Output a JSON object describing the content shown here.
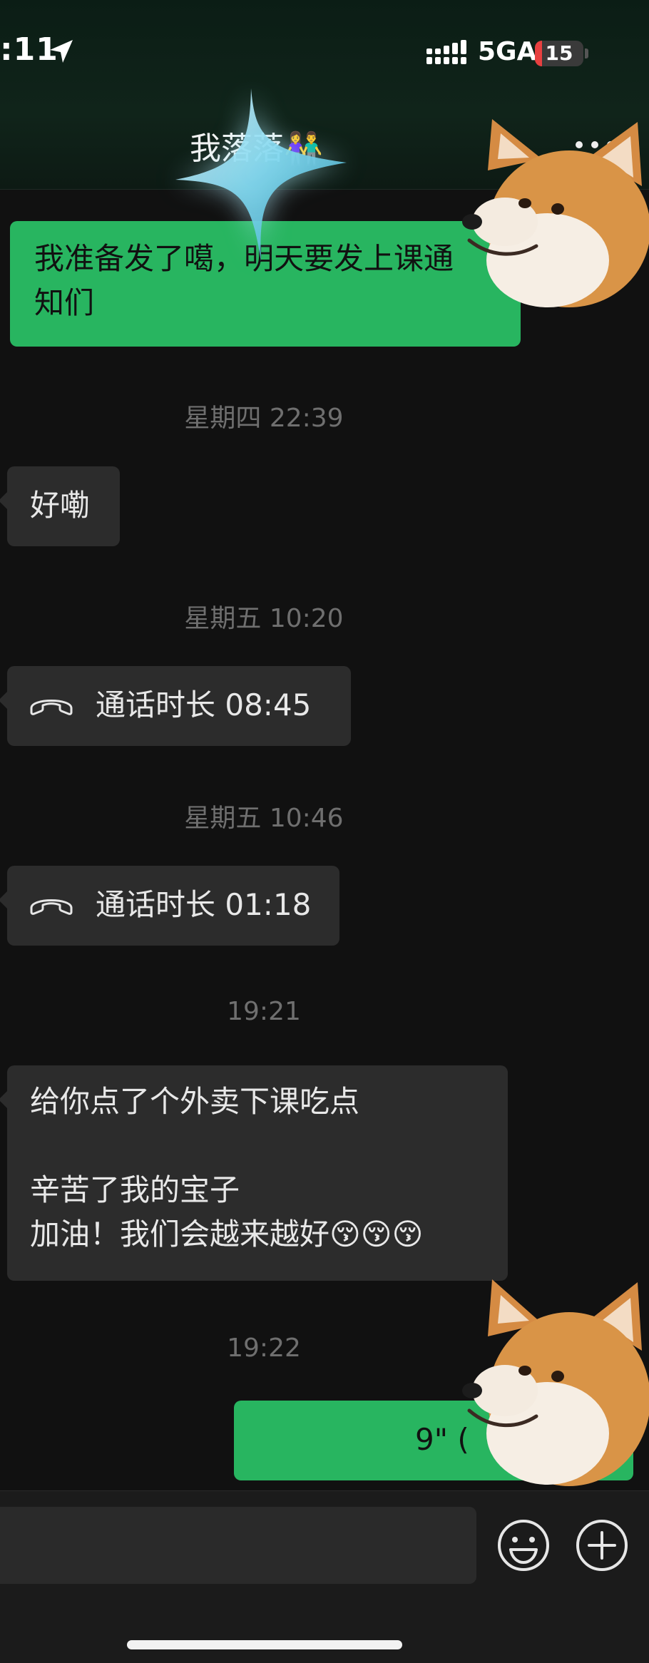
{
  "status_bar": {
    "time": ":11",
    "network": "5GA",
    "battery": "15",
    "battery_level": 0.15
  },
  "header": {
    "title": "我落落👫",
    "more_icon": "ellipsis-icon"
  },
  "messages": [
    {
      "type": "text",
      "side": "right",
      "text_line1": "我准备发了噶，明天要发上课通",
      "text_line2": "知们"
    },
    {
      "type": "time",
      "text": "星期四 22:39"
    },
    {
      "type": "text",
      "side": "left",
      "text": "好嘞"
    },
    {
      "type": "time",
      "text": "星期五 10:20"
    },
    {
      "type": "call",
      "side": "left",
      "icon": "phone-hangup-icon",
      "text": "通话时长 08:45"
    },
    {
      "type": "time",
      "text": "星期五 10:46"
    },
    {
      "type": "call",
      "side": "left",
      "icon": "phone-hangup-icon",
      "text": "通话时长 01:18"
    },
    {
      "type": "time",
      "text": "19:21"
    },
    {
      "type": "text",
      "side": "left",
      "line1": "给你点了个外卖下课吃点",
      "line2": "",
      "line3": "辛苦了我的宝子",
      "line4": "加油！我们会越来越好😚😚😚"
    },
    {
      "type": "time",
      "text": "19:22"
    },
    {
      "type": "voice",
      "side": "right",
      "text": "9\" ("
    }
  ],
  "input_bar": {
    "emoji_icon": "emoji-icon",
    "plus_icon": "plus-circle-icon"
  },
  "colors": {
    "green_bubble": "#28b560",
    "gray_bubble": "#2c2c2c",
    "background": "#111111"
  }
}
